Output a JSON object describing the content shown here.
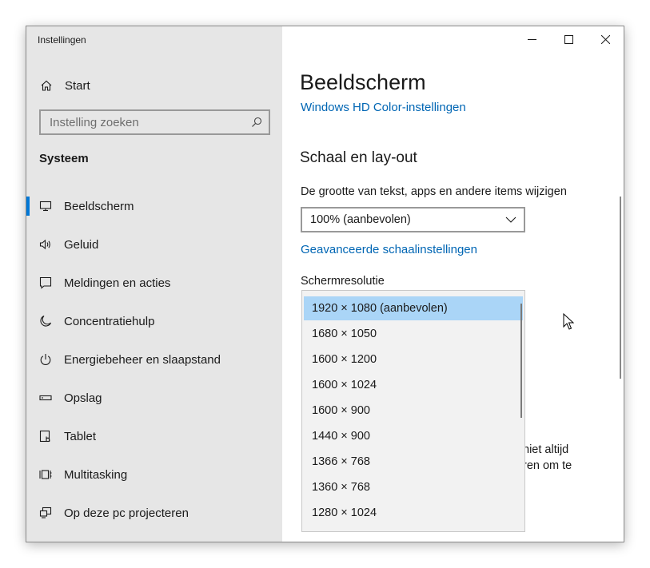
{
  "window": {
    "title": "Instellingen"
  },
  "nav": {
    "home_label": "Start",
    "search_placeholder": "Instelling zoeken",
    "section_heading": "Systeem",
    "items": [
      {
        "label": "Beeldscherm",
        "icon": "monitor-icon",
        "selected": true
      },
      {
        "label": "Geluid",
        "icon": "speaker-icon"
      },
      {
        "label": "Meldingen en acties",
        "icon": "notifications-icon"
      },
      {
        "label": "Concentratiehulp",
        "icon": "moon-icon"
      },
      {
        "label": "Energiebeheer en slaapstand",
        "icon": "power-icon"
      },
      {
        "label": "Opslag",
        "icon": "storage-icon"
      },
      {
        "label": "Tablet",
        "icon": "tablet-icon"
      },
      {
        "label": "Multitasking",
        "icon": "multitasking-icon"
      },
      {
        "label": "Op deze pc projecteren",
        "icon": "project-icon"
      }
    ]
  },
  "content": {
    "page_title": "Beeldscherm",
    "hd_color_link": "Windows HD Color-instellingen",
    "scale_section_heading": "Schaal en lay-out",
    "scale_label": "De grootte van tekst, apps en andere items wijzigen",
    "scale_value": "100% (aanbevolen)",
    "advanced_scaling_link": "Geavanceerde schaalinstellingen",
    "resolution_label": "Schermresolutie",
    "partial_text_line1": "niet altijd",
    "partial_text_line2": "ren om te"
  },
  "resolution_dropdown": {
    "selected_index": 0,
    "options": [
      "1920 × 1080 (aanbevolen)",
      "1680 × 1050",
      "1600 × 1200",
      "1600 × 1024",
      "1600 × 900",
      "1440 × 900",
      "1366 × 768",
      "1360 × 768",
      "1280 × 1024"
    ]
  },
  "colors": {
    "accent": "#0078d7",
    "link": "#0066b4",
    "nav_background": "#e6e6e6",
    "dropdown_selected": "#aad5f7"
  }
}
